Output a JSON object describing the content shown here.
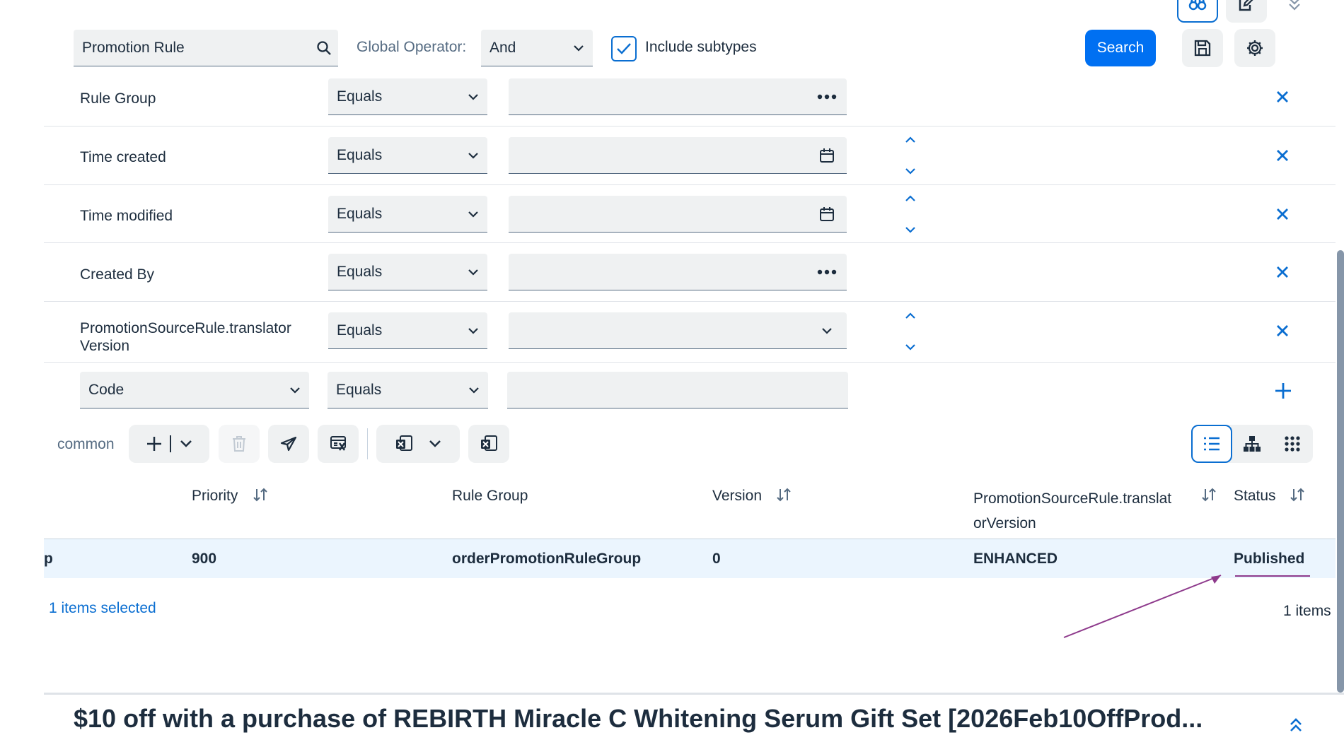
{
  "search": {
    "value": "Promotion Rule",
    "global_operator_label": "Global Operator:",
    "global_operator_value": "And",
    "include_subtypes_label": "Include subtypes",
    "include_subtypes_checked": true,
    "search_button": "Search"
  },
  "conditions": [
    {
      "attribute": "Rule Group",
      "operator": "Equals",
      "value": "",
      "value_icon": "more-icon",
      "has_stepper": false
    },
    {
      "attribute": "Time created",
      "operator": "Equals",
      "value": "",
      "value_icon": "calendar-icon",
      "has_stepper": true
    },
    {
      "attribute": "Time modified",
      "operator": "Equals",
      "value": "",
      "value_icon": "calendar-icon",
      "has_stepper": true
    },
    {
      "attribute": "Created By",
      "operator": "Equals",
      "value": "",
      "value_icon": "more-icon",
      "has_stepper": false
    },
    {
      "attribute_line1": "PromotionSourceRule.translator",
      "attribute_line2": "Version",
      "operator": "Equals",
      "value": "",
      "value_icon": "chevron-down-icon",
      "has_stepper": true
    }
  ],
  "new_condition": {
    "attribute": "Code",
    "operator": "Equals",
    "value": ""
  },
  "toolbar": {
    "label": "common"
  },
  "table": {
    "columns": [
      {
        "label": "Priority",
        "sortable": true
      },
      {
        "label": "Rule Group",
        "sortable": false
      },
      {
        "label": "Version",
        "sortable": true
      },
      {
        "label_line1": "PromotionSourceRule.translat",
        "label_line2": "orVersion",
        "sortable": true
      },
      {
        "label": "Status",
        "sortable": true
      }
    ],
    "rows": [
      {
        "code_fragment": "p",
        "priority": "900",
        "rule_group": "orderPromotionRuleGroup",
        "version": "0",
        "translator_version": "ENHANCED",
        "status": "Published"
      }
    ],
    "selected_text": "1 items selected",
    "count_text": "1 items"
  },
  "detail": {
    "title": "$10 off with a purchase of REBIRTH Miracle C Whitening Serum Gift Set [2026Feb10OffProd..."
  },
  "colors": {
    "accent": "#0a6ed1",
    "primary": "#0070f2",
    "field_bg": "#eff1f2",
    "selected_row": "#ebf5fe",
    "annotation": "#8e3a8c"
  }
}
